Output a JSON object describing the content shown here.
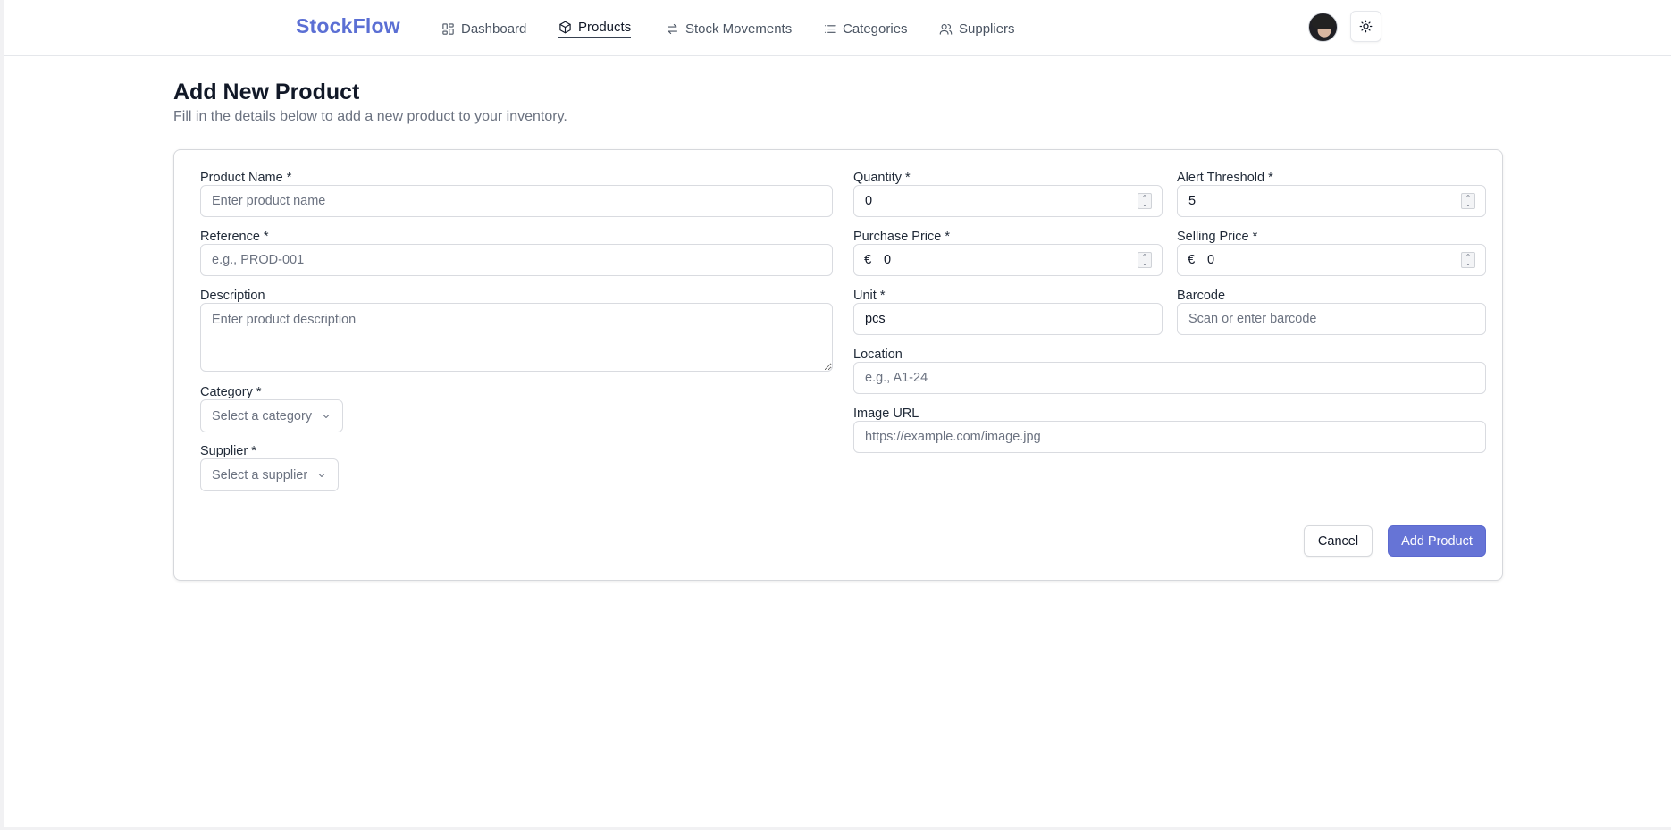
{
  "app": {
    "brand": "StockFlow"
  },
  "nav": {
    "items": [
      {
        "label": "Dashboard",
        "icon": "dashboard-icon"
      },
      {
        "label": "Products",
        "icon": "box-icon",
        "active": true
      },
      {
        "label": "Stock Movements",
        "icon": "arrows-icon"
      },
      {
        "label": "Categories",
        "icon": "list-icon"
      },
      {
        "label": "Suppliers",
        "icon": "users-icon"
      }
    ]
  },
  "header": {
    "avatar": "user-avatar",
    "theme_toggle_icon": "sun-icon"
  },
  "page": {
    "title": "Add New Product",
    "subtitle": "Fill in the details below to add a new product to your inventory."
  },
  "form": {
    "product_name": {
      "label": "Product Name *",
      "placeholder": "Enter product name",
      "value": ""
    },
    "reference": {
      "label": "Reference *",
      "placeholder": "e.g., PROD-001",
      "value": ""
    },
    "description": {
      "label": "Description",
      "placeholder": "Enter product description",
      "value": ""
    },
    "category": {
      "label": "Category *",
      "placeholder": "Select a category"
    },
    "supplier": {
      "label": "Supplier *",
      "placeholder": "Select a supplier"
    },
    "quantity": {
      "label": "Quantity *",
      "value": "0"
    },
    "alert_threshold": {
      "label": "Alert Threshold *",
      "value": "5"
    },
    "purchase_price": {
      "label": "Purchase Price *",
      "currency": "€",
      "value": "0"
    },
    "selling_price": {
      "label": "Selling Price *",
      "currency": "€",
      "value": "0"
    },
    "unit": {
      "label": "Unit *",
      "value": "pcs"
    },
    "barcode": {
      "label": "Barcode",
      "placeholder": "Scan or enter barcode",
      "value": ""
    },
    "location": {
      "label": "Location",
      "placeholder": "e.g., A1-24",
      "value": ""
    },
    "image_url": {
      "label": "Image URL",
      "placeholder": "https://example.com/image.jpg",
      "value": ""
    }
  },
  "actions": {
    "cancel": "Cancel",
    "submit": "Add Product"
  },
  "colors": {
    "brand": "#5b6fd4",
    "primary_button": "#6674d6",
    "border": "#d9dbe0"
  }
}
